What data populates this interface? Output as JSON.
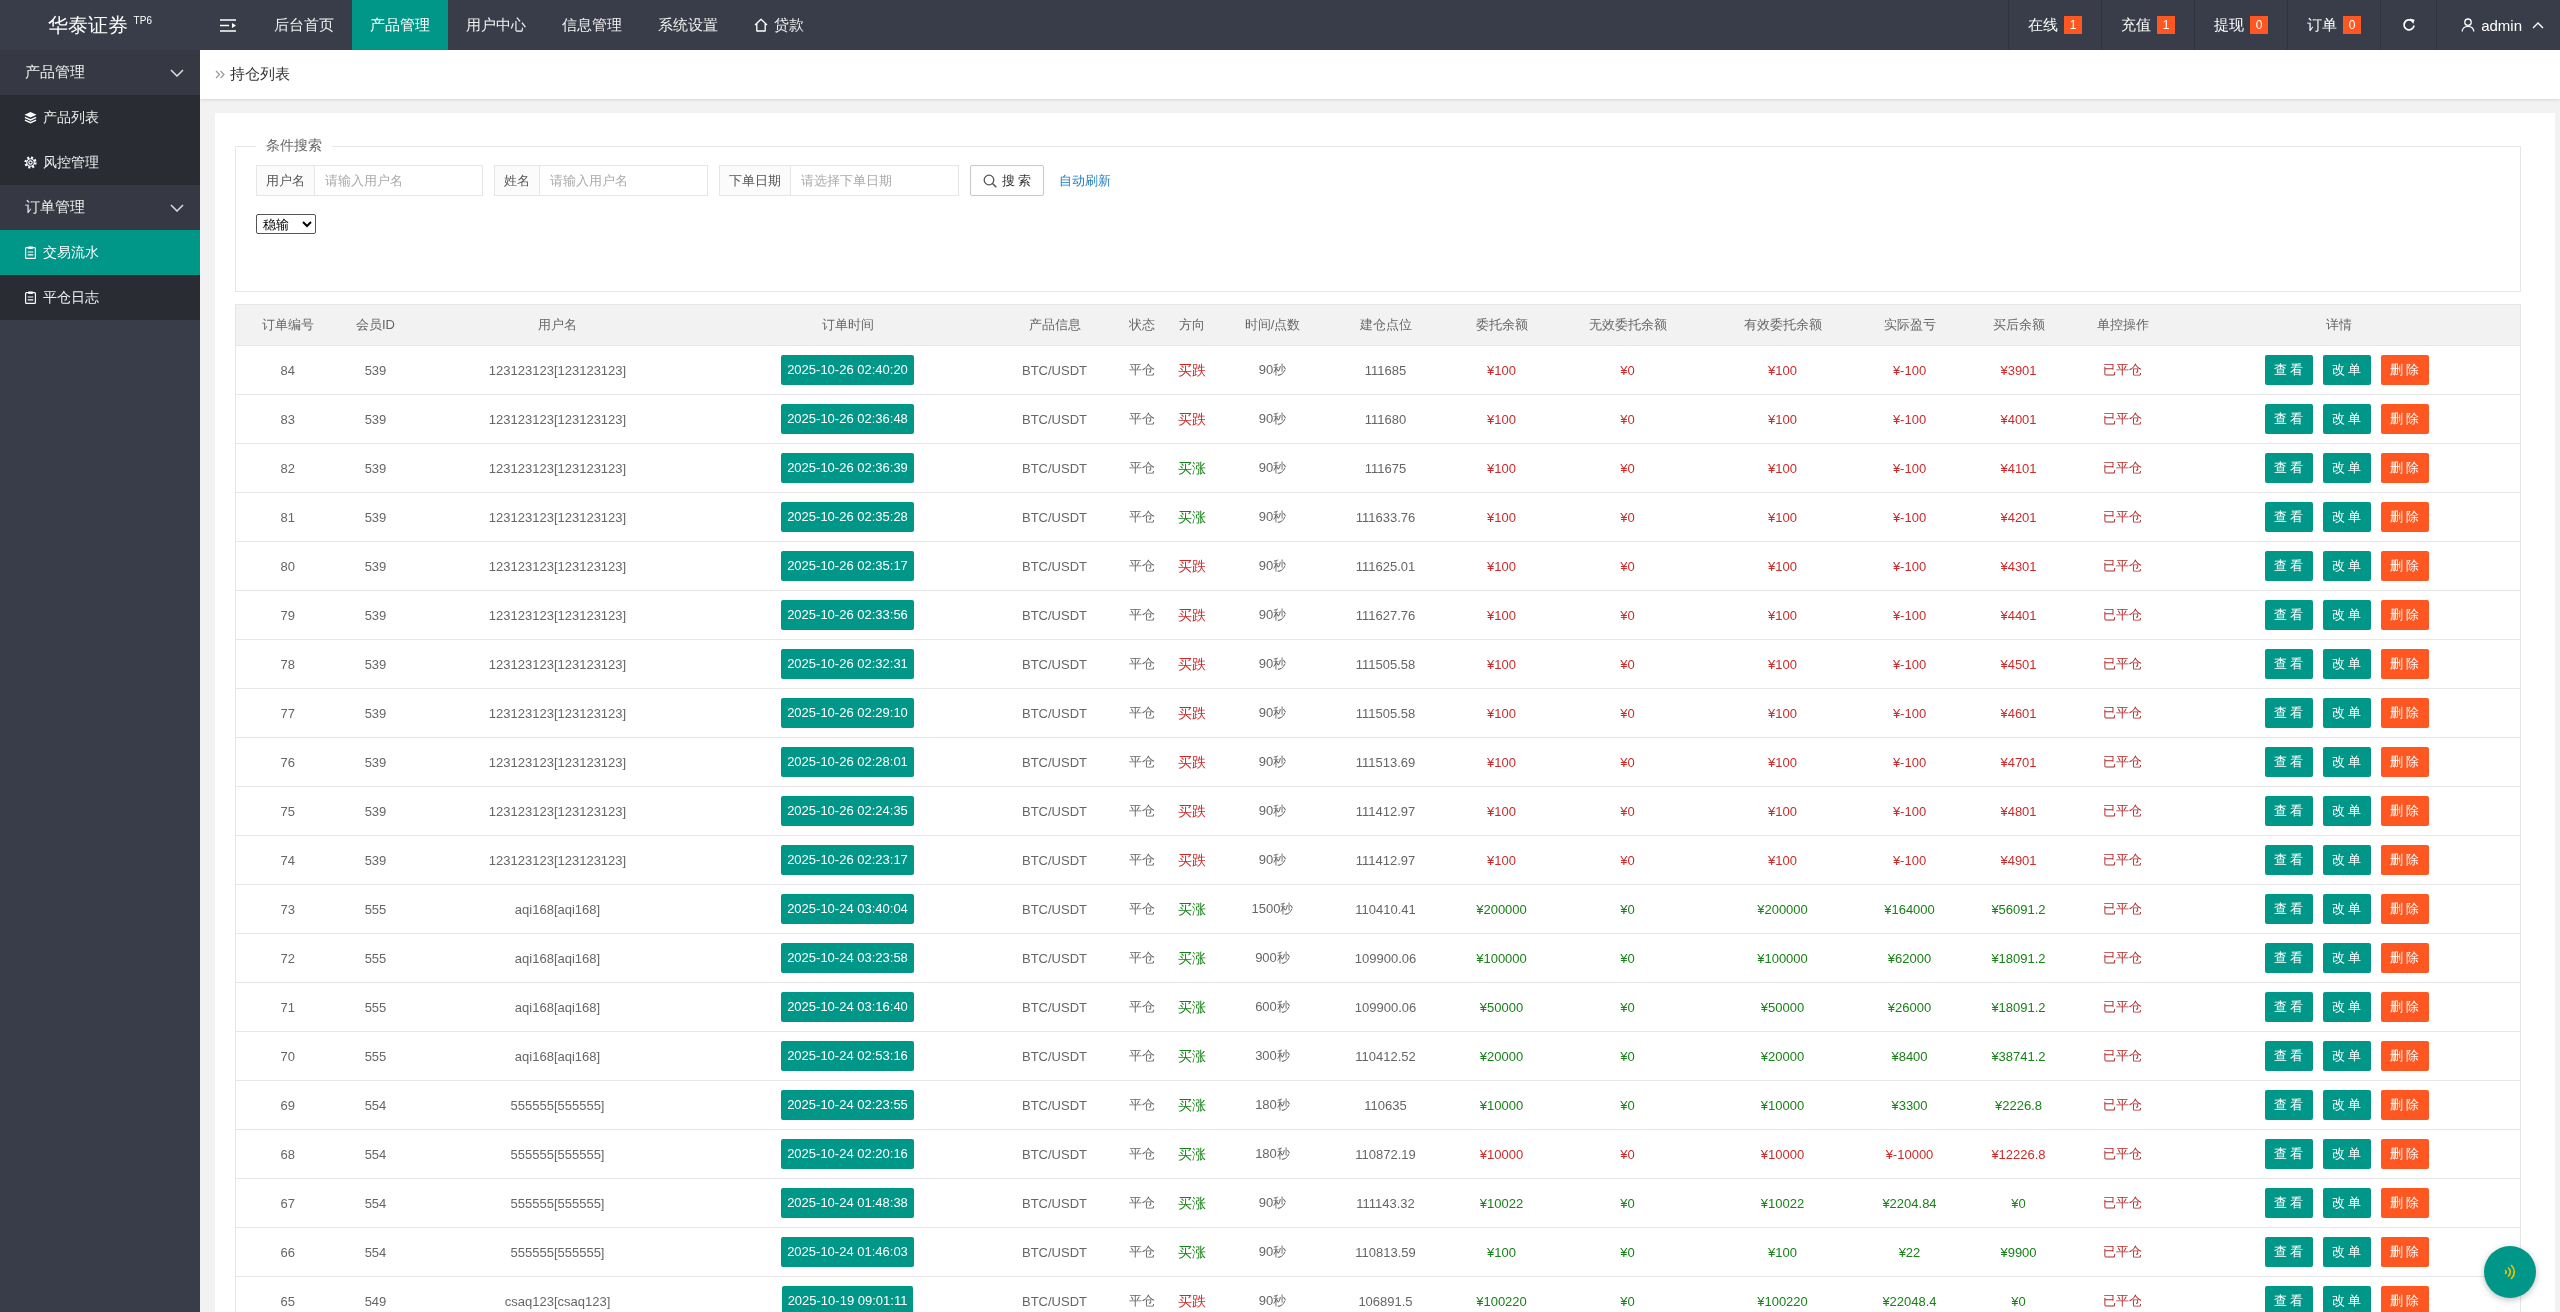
{
  "header": {
    "logo": "华泰证券 $^{TP6}$",
    "nav": [
      {
        "label": "后台首页",
        "kind": "plain",
        "selected": false
      },
      {
        "label": "产品管理",
        "kind": "plain",
        "selected": true
      },
      {
        "label": "用户中心",
        "kind": "plain",
        "selected": false
      },
      {
        "label": "信息管理",
        "kind": "plain",
        "selected": false
      },
      {
        "label": "系统设置",
        "kind": "plain",
        "selected": false
      },
      {
        "label": "贷款",
        "kind": "home",
        "selected": false
      }
    ],
    "stats": [
      {
        "label": "在线",
        "count": "1"
      },
      {
        "label": "充值",
        "count": "1"
      },
      {
        "label": "提现",
        "count": "0"
      },
      {
        "label": "订单",
        "count": "0"
      }
    ],
    "user": {
      "name": "admin"
    }
  },
  "sidebar": {
    "groups": [
      {
        "label": "产品管理",
        "expanded": true,
        "children": [
          {
            "label": "产品列表",
            "kind": "layers",
            "selected": false
          },
          {
            "label": "风控管理",
            "kind": "gear",
            "selected": false
          }
        ]
      },
      {
        "label": "订单管理",
        "expanded": true,
        "children": [
          {
            "label": "交易流水",
            "kind": "clipboard",
            "selected": true
          },
          {
            "label": "平仓日志",
            "kind": "clipboard",
            "selected": false
          }
        ]
      }
    ]
  },
  "breadcrumb": {
    "items": [
      "持仓列表"
    ]
  },
  "search": {
    "legend": "条件搜索",
    "fields": [
      {
        "label": "用户名",
        "placeholder": "请输入用户名"
      },
      {
        "label": "姓名",
        "placeholder": "请输入用户名"
      },
      {
        "label": "下单日期",
        "placeholder": "请选择下单日期"
      }
    ],
    "button": "搜 索",
    "auto_refresh": "自动刷新",
    "select": {
      "value": "稳输"
    }
  },
  "table": {
    "columns": [
      "订单编号",
      "会员ID",
      "用户名",
      "订单时间",
      "产品信息",
      "状态",
      "方向",
      "时间/点数",
      "建仓点位",
      "委托余额",
      "无效委托余额",
      "有效委托余额",
      "实际盈亏",
      "买后余额",
      "单控操作",
      "详情"
    ],
    "rows": [
      {
        "order_no": "84",
        "member_id": "539",
        "username": "123123123[123123123]",
        "order_time": "2025-10-26 02:40:20",
        "product": "BTC/USDT",
        "status": "平仓",
        "direction": {
          "label": "买跌",
          "color": "#cc2a2a"
        },
        "duration": "90秒",
        "open_price": "111685",
        "amount": "¥100",
        "invalid_amount": "¥0",
        "valid_amount": "¥100",
        "pnl": "¥-100",
        "balance_after": "¥3901",
        "color": "#cc2a2a",
        "control": "已平仓",
        "actions": [
          {
            "label": "查看",
            "kind": "view"
          },
          {
            "label": "改单",
            "kind": "edit"
          },
          {
            "label": "删除",
            "kind": "delete"
          }
        ]
      },
      {
        "order_no": "83",
        "member_id": "539",
        "username": "123123123[123123123]",
        "order_time": "2025-10-26 02:36:48",
        "product": "BTC/USDT",
        "status": "平仓",
        "direction": {
          "label": "买跌",
          "color": "#cc2a2a"
        },
        "duration": "90秒",
        "open_price": "111680",
        "amount": "¥100",
        "invalid_amount": "¥0",
        "valid_amount": "¥100",
        "pnl": "¥-100",
        "balance_after": "¥4001",
        "color": "#cc2a2a",
        "control": "已平仓",
        "actions": [
          {
            "label": "查看",
            "kind": "view"
          },
          {
            "label": "改单",
            "kind": "edit"
          },
          {
            "label": "删除",
            "kind": "delete"
          }
        ]
      },
      {
        "order_no": "82",
        "member_id": "539",
        "username": "123123123[123123123]",
        "order_time": "2025-10-26 02:36:39",
        "product": "BTC/USDT",
        "status": "平仓",
        "direction": {
          "label": "买涨",
          "color": "#178217"
        },
        "duration": "90秒",
        "open_price": "111675",
        "amount": "¥100",
        "invalid_amount": "¥0",
        "valid_amount": "¥100",
        "pnl": "¥-100",
        "balance_after": "¥4101",
        "color": "#cc2a2a",
        "control": "已平仓",
        "actions": [
          {
            "label": "查看",
            "kind": "view"
          },
          {
            "label": "改单",
            "kind": "edit"
          },
          {
            "label": "删除",
            "kind": "delete"
          }
        ]
      },
      {
        "order_no": "81",
        "member_id": "539",
        "username": "123123123[123123123]",
        "order_time": "2025-10-26 02:35:28",
        "product": "BTC/USDT",
        "status": "平仓",
        "direction": {
          "label": "买涨",
          "color": "#178217"
        },
        "duration": "90秒",
        "open_price": "111633.76",
        "amount": "¥100",
        "invalid_amount": "¥0",
        "valid_amount": "¥100",
        "pnl": "¥-100",
        "balance_after": "¥4201",
        "color": "#cc2a2a",
        "control": "已平仓",
        "actions": [
          {
            "label": "查看",
            "kind": "view"
          },
          {
            "label": "改单",
            "kind": "edit"
          },
          {
            "label": "删除",
            "kind": "delete"
          }
        ]
      },
      {
        "order_no": "80",
        "member_id": "539",
        "username": "123123123[123123123]",
        "order_time": "2025-10-26 02:35:17",
        "product": "BTC/USDT",
        "status": "平仓",
        "direction": {
          "label": "买跌",
          "color": "#cc2a2a"
        },
        "duration": "90秒",
        "open_price": "111625.01",
        "amount": "¥100",
        "invalid_amount": "¥0",
        "valid_amount": "¥100",
        "pnl": "¥-100",
        "balance_after": "¥4301",
        "color": "#cc2a2a",
        "control": "已平仓",
        "actions": [
          {
            "label": "查看",
            "kind": "view"
          },
          {
            "label": "改单",
            "kind": "edit"
          },
          {
            "label": "删除",
            "kind": "delete"
          }
        ]
      },
      {
        "order_no": "79",
        "member_id": "539",
        "username": "123123123[123123123]",
        "order_time": "2025-10-26 02:33:56",
        "product": "BTC/USDT",
        "status": "平仓",
        "direction": {
          "label": "买跌",
          "color": "#cc2a2a"
        },
        "duration": "90秒",
        "open_price": "111627.76",
        "amount": "¥100",
        "invalid_amount": "¥0",
        "valid_amount": "¥100",
        "pnl": "¥-100",
        "balance_after": "¥4401",
        "color": "#cc2a2a",
        "control": "已平仓",
        "actions": [
          {
            "label": "查看",
            "kind": "view"
          },
          {
            "label": "改单",
            "kind": "edit"
          },
          {
            "label": "删除",
            "kind": "delete"
          }
        ]
      },
      {
        "order_no": "78",
        "member_id": "539",
        "username": "123123123[123123123]",
        "order_time": "2025-10-26 02:32:31",
        "product": "BTC/USDT",
        "status": "平仓",
        "direction": {
          "label": "买跌",
          "color": "#cc2a2a"
        },
        "duration": "90秒",
        "open_price": "111505.58",
        "amount": "¥100",
        "invalid_amount": "¥0",
        "valid_amount": "¥100",
        "pnl": "¥-100",
        "balance_after": "¥4501",
        "color": "#cc2a2a",
        "control": "已平仓",
        "actions": [
          {
            "label": "查看",
            "kind": "view"
          },
          {
            "label": "改单",
            "kind": "edit"
          },
          {
            "label": "删除",
            "kind": "delete"
          }
        ]
      },
      {
        "order_no": "77",
        "member_id": "539",
        "username": "123123123[123123123]",
        "order_time": "2025-10-26 02:29:10",
        "product": "BTC/USDT",
        "status": "平仓",
        "direction": {
          "label": "买跌",
          "color": "#cc2a2a"
        },
        "duration": "90秒",
        "open_price": "111505.58",
        "amount": "¥100",
        "invalid_amount": "¥0",
        "valid_amount": "¥100",
        "pnl": "¥-100",
        "balance_after": "¥4601",
        "color": "#cc2a2a",
        "control": "已平仓",
        "actions": [
          {
            "label": "查看",
            "kind": "view"
          },
          {
            "label": "改单",
            "kind": "edit"
          },
          {
            "label": "删除",
            "kind": "delete"
          }
        ]
      },
      {
        "order_no": "76",
        "member_id": "539",
        "username": "123123123[123123123]",
        "order_time": "2025-10-26 02:28:01",
        "product": "BTC/USDT",
        "status": "平仓",
        "direction": {
          "label": "买跌",
          "color": "#cc2a2a"
        },
        "duration": "90秒",
        "open_price": "111513.69",
        "amount": "¥100",
        "invalid_amount": "¥0",
        "valid_amount": "¥100",
        "pnl": "¥-100",
        "balance_after": "¥4701",
        "color": "#cc2a2a",
        "control": "已平仓",
        "actions": [
          {
            "label": "查看",
            "kind": "view"
          },
          {
            "label": "改单",
            "kind": "edit"
          },
          {
            "label": "删除",
            "kind": "delete"
          }
        ]
      },
      {
        "order_no": "75",
        "member_id": "539",
        "username": "123123123[123123123]",
        "order_time": "2025-10-26 02:24:35",
        "product": "BTC/USDT",
        "status": "平仓",
        "direction": {
          "label": "买跌",
          "color": "#cc2a2a"
        },
        "duration": "90秒",
        "open_price": "111412.97",
        "amount": "¥100",
        "invalid_amount": "¥0",
        "valid_amount": "¥100",
        "pnl": "¥-100",
        "balance_after": "¥4801",
        "color": "#cc2a2a",
        "control": "已平仓",
        "actions": [
          {
            "label": "查看",
            "kind": "view"
          },
          {
            "label": "改单",
            "kind": "edit"
          },
          {
            "label": "删除",
            "kind": "delete"
          }
        ]
      },
      {
        "order_no": "74",
        "member_id": "539",
        "username": "123123123[123123123]",
        "order_time": "2025-10-26 02:23:17",
        "product": "BTC/USDT",
        "status": "平仓",
        "direction": {
          "label": "买跌",
          "color": "#cc2a2a"
        },
        "duration": "90秒",
        "open_price": "111412.97",
        "amount": "¥100",
        "invalid_amount": "¥0",
        "valid_amount": "¥100",
        "pnl": "¥-100",
        "balance_after": "¥4901",
        "color": "#cc2a2a",
        "control": "已平仓",
        "actions": [
          {
            "label": "查看",
            "kind": "view"
          },
          {
            "label": "改单",
            "kind": "edit"
          },
          {
            "label": "删除",
            "kind": "delete"
          }
        ]
      },
      {
        "order_no": "73",
        "member_id": "555",
        "username": "aqi168[aqi168]",
        "order_time": "2025-10-24 03:40:04",
        "product": "BTC/USDT",
        "status": "平仓",
        "direction": {
          "label": "买涨",
          "color": "#178217"
        },
        "duration": "1500秒",
        "open_price": "110410.41",
        "amount": "¥200000",
        "invalid_amount": "¥0",
        "valid_amount": "¥200000",
        "pnl": "¥164000",
        "balance_after": "¥56091.2",
        "color": "#178217",
        "control": "已平仓",
        "actions": [
          {
            "label": "查看",
            "kind": "view"
          },
          {
            "label": "改单",
            "kind": "edit"
          },
          {
            "label": "删除",
            "kind": "delete"
          }
        ]
      },
      {
        "order_no": "72",
        "member_id": "555",
        "username": "aqi168[aqi168]",
        "order_time": "2025-10-24 03:23:58",
        "product": "BTC/USDT",
        "status": "平仓",
        "direction": {
          "label": "买涨",
          "color": "#178217"
        },
        "duration": "900秒",
        "open_price": "109900.06",
        "amount": "¥100000",
        "invalid_amount": "¥0",
        "valid_amount": "¥100000",
        "pnl": "¥62000",
        "balance_after": "¥18091.2",
        "color": "#178217",
        "control": "已平仓",
        "actions": [
          {
            "label": "查看",
            "kind": "view"
          },
          {
            "label": "改单",
            "kind": "edit"
          },
          {
            "label": "删除",
            "kind": "delete"
          }
        ]
      },
      {
        "order_no": "71",
        "member_id": "555",
        "username": "aqi168[aqi168]",
        "order_time": "2025-10-24 03:16:40",
        "product": "BTC/USDT",
        "status": "平仓",
        "direction": {
          "label": "买涨",
          "color": "#178217"
        },
        "duration": "600秒",
        "open_price": "109900.06",
        "amount": "¥50000",
        "invalid_amount": "¥0",
        "valid_amount": "¥50000",
        "pnl": "¥26000",
        "balance_after": "¥18091.2",
        "color": "#178217",
        "control": "已平仓",
        "actions": [
          {
            "label": "查看",
            "kind": "view"
          },
          {
            "label": "改单",
            "kind": "edit"
          },
          {
            "label": "删除",
            "kind": "delete"
          }
        ]
      },
      {
        "order_no": "70",
        "member_id": "555",
        "username": "aqi168[aqi168]",
        "order_time": "2025-10-24 02:53:16",
        "product": "BTC/USDT",
        "status": "平仓",
        "direction": {
          "label": "买涨",
          "color": "#178217"
        },
        "duration": "300秒",
        "open_price": "110412.52",
        "amount": "¥20000",
        "invalid_amount": "¥0",
        "valid_amount": "¥20000",
        "pnl": "¥8400",
        "balance_after": "¥38741.2",
        "color": "#178217",
        "control": "已平仓",
        "actions": [
          {
            "label": "查看",
            "kind": "view"
          },
          {
            "label": "改单",
            "kind": "edit"
          },
          {
            "label": "删除",
            "kind": "delete"
          }
        ]
      },
      {
        "order_no": "69",
        "member_id": "554",
        "username": "555555[555555]",
        "order_time": "2025-10-24 02:23:55",
        "product": "BTC/USDT",
        "status": "平仓",
        "direction": {
          "label": "买涨",
          "color": "#178217"
        },
        "duration": "180秒",
        "open_price": "110635",
        "amount": "¥10000",
        "invalid_amount": "¥0",
        "valid_amount": "¥10000",
        "pnl": "¥3300",
        "balance_after": "¥2226.8",
        "color": "#178217",
        "control": "已平仓",
        "actions": [
          {
            "label": "查看",
            "kind": "view"
          },
          {
            "label": "改单",
            "kind": "edit"
          },
          {
            "label": "删除",
            "kind": "delete"
          }
        ]
      },
      {
        "order_no": "68",
        "member_id": "554",
        "username": "555555[555555]",
        "order_time": "2025-10-24 02:20:16",
        "product": "BTC/USDT",
        "status": "平仓",
        "direction": {
          "label": "买涨",
          "color": "#178217"
        },
        "duration": "180秒",
        "open_price": "110872.19",
        "amount": "¥10000",
        "invalid_amount": "¥0",
        "valid_amount": "¥10000",
        "pnl": "¥-10000",
        "balance_after": "¥12226.8",
        "color": "#cc2a2a",
        "control": "已平仓",
        "actions": [
          {
            "label": "查看",
            "kind": "view"
          },
          {
            "label": "改单",
            "kind": "edit"
          },
          {
            "label": "删除",
            "kind": "delete"
          }
        ]
      },
      {
        "order_no": "67",
        "member_id": "554",
        "username": "555555[555555]",
        "order_time": "2025-10-24 01:48:38",
        "product": "BTC/USDT",
        "status": "平仓",
        "direction": {
          "label": "买涨",
          "color": "#178217"
        },
        "duration": "90秒",
        "open_price": "111143.32",
        "amount": "¥10022",
        "invalid_amount": "¥0",
        "valid_amount": "¥10022",
        "pnl": "¥2204.84",
        "balance_after": "¥0",
        "color": "#178217",
        "control": "已平仓",
        "actions": [
          {
            "label": "查看",
            "kind": "view"
          },
          {
            "label": "改单",
            "kind": "edit"
          },
          {
            "label": "删除",
            "kind": "delete"
          }
        ]
      },
      {
        "order_no": "66",
        "member_id": "554",
        "username": "555555[555555]",
        "order_time": "2025-10-24 01:46:03",
        "product": "BTC/USDT",
        "status": "平仓",
        "direction": {
          "label": "买涨",
          "color": "#178217"
        },
        "duration": "90秒",
        "open_price": "110813.59",
        "amount": "¥100",
        "invalid_amount": "¥0",
        "valid_amount": "¥100",
        "pnl": "¥22",
        "balance_after": "¥9900",
        "color": "#178217",
        "control": "已平仓",
        "actions": [
          {
            "label": "查看",
            "kind": "view"
          },
          {
            "label": "改单",
            "kind": "edit"
          },
          {
            "label": "删除",
            "kind": "delete"
          }
        ]
      },
      {
        "order_no": "65",
        "member_id": "549",
        "username": "csaq123[csaq123]",
        "order_time": "2025-10-19 09:01:11",
        "product": "BTC/USDT",
        "status": "平仓",
        "direction": {
          "label": "买跌",
          "color": "#cc2a2a"
        },
        "duration": "90秒",
        "open_price": "106891.5",
        "amount": "¥100220",
        "invalid_amount": "¥0",
        "valid_amount": "¥100220",
        "pnl": "¥22048.4",
        "balance_after": "¥0",
        "color": "#178217",
        "control": "已平仓",
        "actions": [
          {
            "label": "查看",
            "kind": "view"
          },
          {
            "label": "改单",
            "kind": "edit"
          },
          {
            "label": "删除",
            "kind": "delete"
          }
        ]
      }
    ]
  }
}
